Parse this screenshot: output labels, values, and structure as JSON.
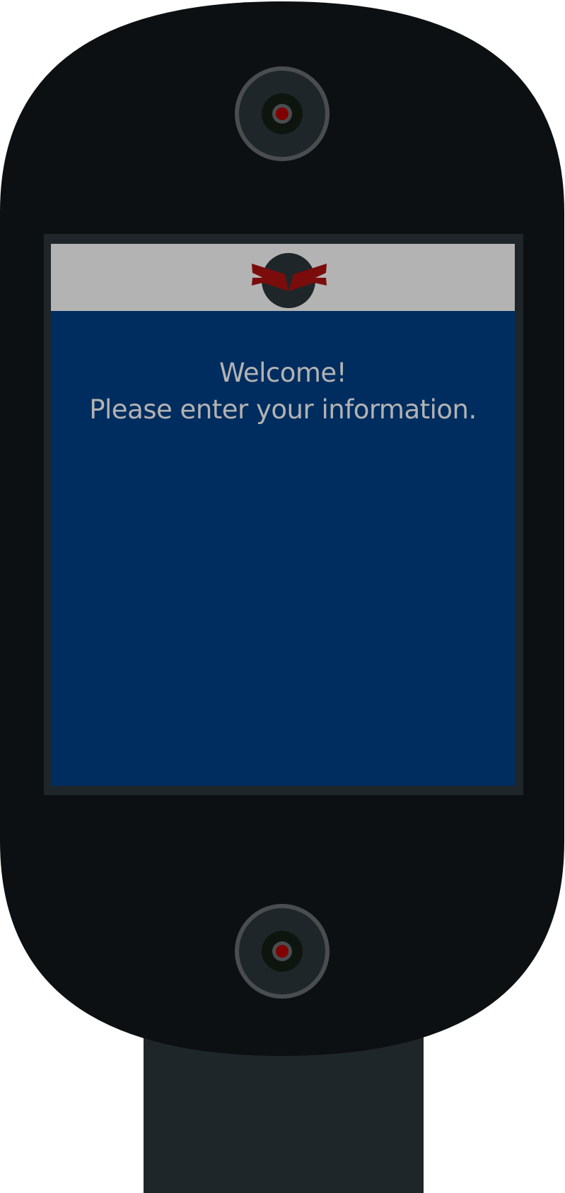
{
  "screen": {
    "welcome_title": "Welcome!",
    "welcome_message": "Please enter your information."
  },
  "colors": {
    "body": "#0d1012",
    "stand": "#1f2629",
    "bezel": "#1f2629",
    "header_bar": "#b3b3b3",
    "screen_background": "#002d5f",
    "text": "#b3b3b3",
    "logo_accent": "#7a0c0c",
    "camera_ring": "#4a4d50",
    "camera_lens": "#0e150f",
    "camera_indicator": "#800000"
  },
  "icons": {
    "header_logo": "winged-emblem-icon",
    "top_device": "camera-icon",
    "bottom_device": "camera-icon"
  }
}
